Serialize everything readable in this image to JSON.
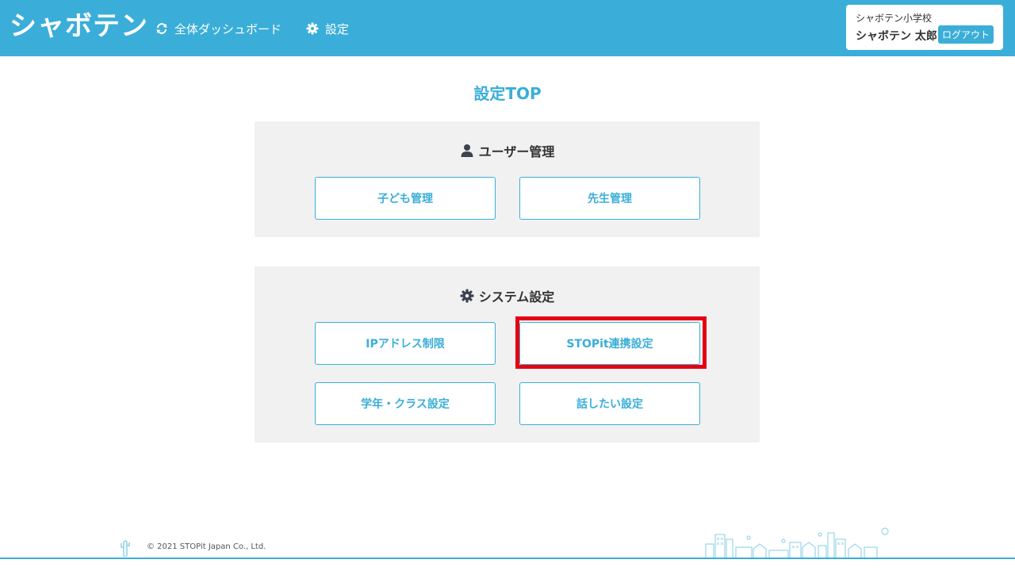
{
  "header": {
    "logo": "シャボテン",
    "nav": {
      "dashboard_label": "全体ダッシュボード",
      "dashboard_icon": "refresh-icon",
      "settings_label": "設定",
      "settings_icon": "gear-icon"
    },
    "user": {
      "school": "シャボテン小学校",
      "name": "シャボテン 太郎",
      "logout_label": "ログアウト"
    }
  },
  "main": {
    "title": "設定TOP",
    "sections": [
      {
        "heading": "ユーザー管理",
        "icon": "user-icon",
        "buttons": [
          "子ども管理",
          "先生管理"
        ]
      },
      {
        "heading": "システム設定",
        "icon": "gear-icon",
        "buttons": [
          "IPアドレス制限",
          "STOPit連携設定",
          "学年・クラス設定",
          "話したい設定"
        ]
      }
    ]
  },
  "footer": {
    "copyright": "© 2021 STOPit Japan Co., Ltd."
  },
  "colors": {
    "brand": "#3aaed8",
    "panel_bg": "#f1f1f1",
    "highlight": "#e60012"
  }
}
